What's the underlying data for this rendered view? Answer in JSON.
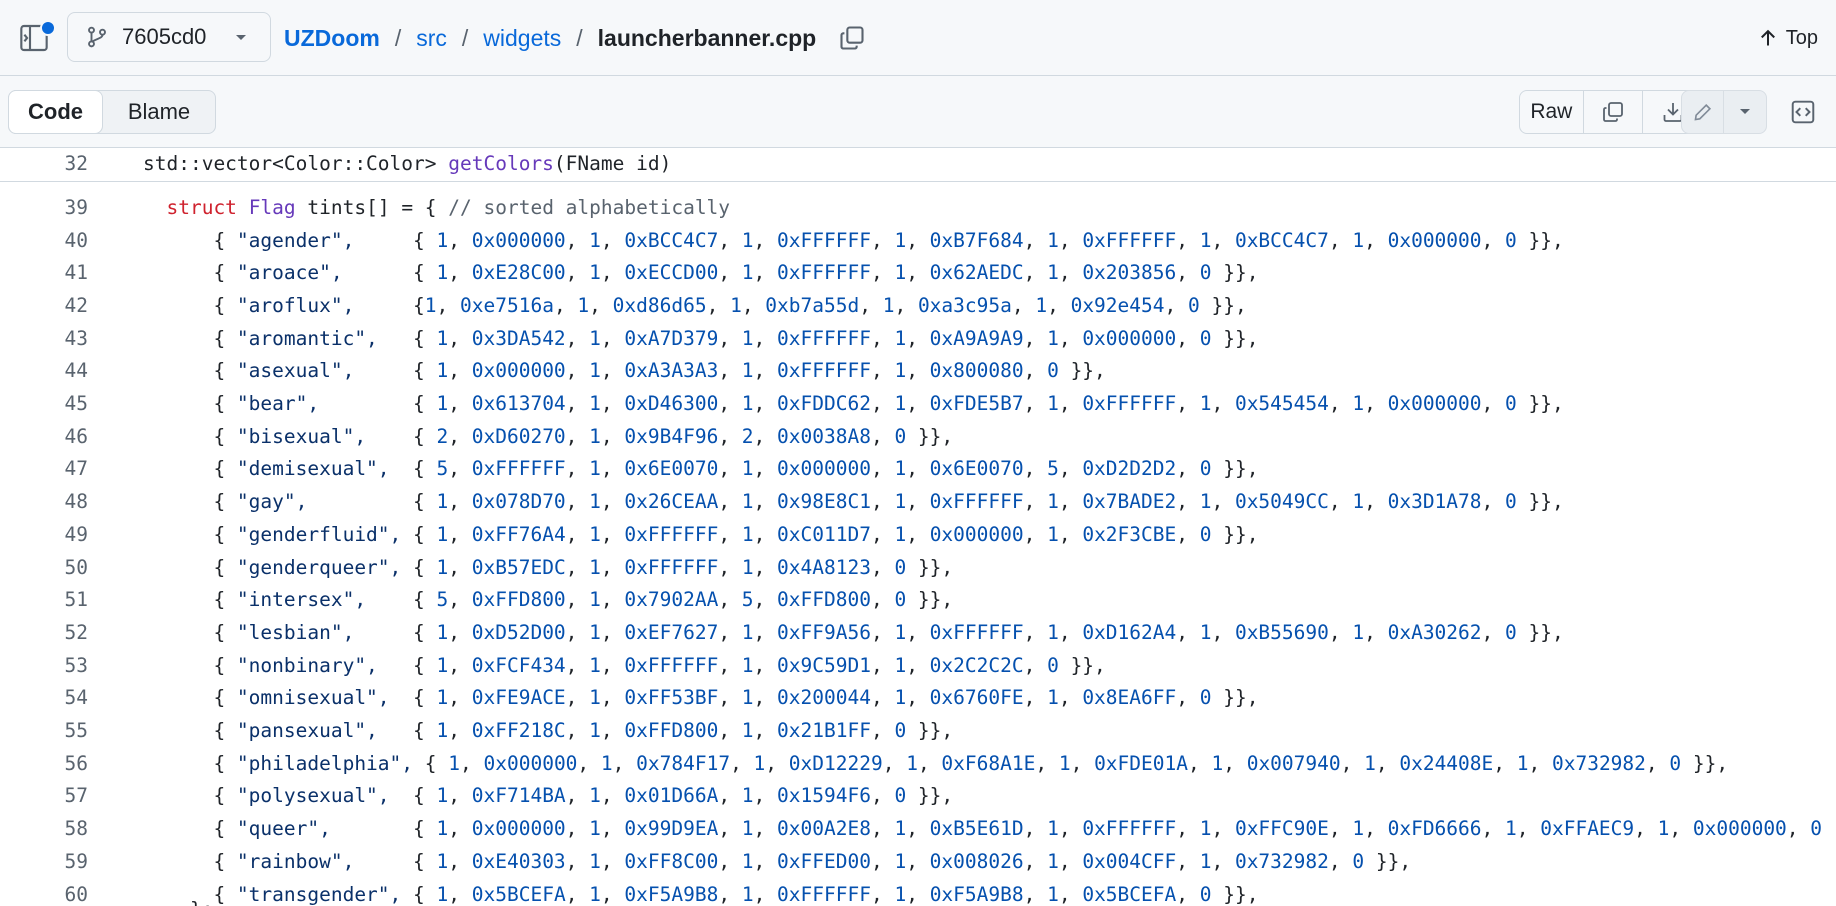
{
  "header": {
    "branch": "7605cd0",
    "breadcrumb": {
      "repo": "UZDoom",
      "path": [
        "src",
        "widgets"
      ],
      "sep": "/",
      "file": "launcherbanner.cpp"
    },
    "top_label": "Top"
  },
  "toolbar": {
    "tabs": [
      "Code",
      "Blame"
    ],
    "active_tab": "Code",
    "raw_label": "Raw"
  },
  "sticky": {
    "line": "32",
    "return_type": "std::vector<Color::Color> ",
    "func": "getColors",
    "params": "(FName id)"
  },
  "code": {
    "struct_line": {
      "ln": "39",
      "kw": "struct",
      "type": "Flag",
      "rest": " tints[] = { ",
      "comment": "// sorted alphabetically"
    },
    "flags": [
      {
        "ln": "40",
        "name": "\"agender\",",
        "values": [
          "1",
          "0x000000",
          "1",
          "0xBCC4C7",
          "1",
          "0xFFFFFF",
          "1",
          "0xB7F684",
          "1",
          "0xFFFFFF",
          "1",
          "0xBCC4C7",
          "1",
          "0x000000",
          "0"
        ]
      },
      {
        "ln": "41",
        "name": "\"aroace\",",
        "values": [
          "1",
          "0xE28C00",
          "1",
          "0xECCD00",
          "1",
          "0xFFFFFF",
          "1",
          "0x62AEDC",
          "1",
          "0x203856",
          "0"
        ]
      },
      {
        "ln": "42",
        "name": "\"aroflux\",",
        "nospace": true,
        "values": [
          "1",
          "0xe7516a",
          "1",
          "0xd86d65",
          "1",
          "0xb7a55d",
          "1",
          "0xa3c95a",
          "1",
          "0x92e454",
          "0"
        ]
      },
      {
        "ln": "43",
        "name": "\"aromantic\",",
        "values": [
          "1",
          "0x3DA542",
          "1",
          "0xA7D379",
          "1",
          "0xFFFFFF",
          "1",
          "0xA9A9A9",
          "1",
          "0x000000",
          "0"
        ]
      },
      {
        "ln": "44",
        "name": "\"asexual\",",
        "values": [
          "1",
          "0x000000",
          "1",
          "0xA3A3A3",
          "1",
          "0xFFFFFF",
          "1",
          "0x800080",
          "0"
        ]
      },
      {
        "ln": "45",
        "name": "\"bear\",",
        "values": [
          "1",
          "0x613704",
          "1",
          "0xD46300",
          "1",
          "0xFDDC62",
          "1",
          "0xFDE5B7",
          "1",
          "0xFFFFFF",
          "1",
          "0x545454",
          "1",
          "0x000000",
          "0"
        ]
      },
      {
        "ln": "46",
        "name": "\"bisexual\",",
        "values": [
          "2",
          "0xD60270",
          "1",
          "0x9B4F96",
          "2",
          "0x0038A8",
          "0"
        ]
      },
      {
        "ln": "47",
        "name": "\"demisexual\",",
        "values": [
          "5",
          "0xFFFFFF",
          "1",
          "0x6E0070",
          "1",
          "0x000000",
          "1",
          "0x6E0070",
          "5",
          "0xD2D2D2",
          "0"
        ]
      },
      {
        "ln": "48",
        "name": "\"gay\",",
        "values": [
          "1",
          "0x078D70",
          "1",
          "0x26CEAA",
          "1",
          "0x98E8C1",
          "1",
          "0xFFFFFF",
          "1",
          "0x7BADE2",
          "1",
          "0x5049CC",
          "1",
          "0x3D1A78",
          "0"
        ]
      },
      {
        "ln": "49",
        "name": "\"genderfluid\",",
        "values": [
          "1",
          "0xFF76A4",
          "1",
          "0xFFFFFF",
          "1",
          "0xC011D7",
          "1",
          "0x000000",
          "1",
          "0x2F3CBE",
          "0"
        ]
      },
      {
        "ln": "50",
        "name": "\"genderqueer\",",
        "values": [
          "1",
          "0xB57EDC",
          "1",
          "0xFFFFFF",
          "1",
          "0x4A8123",
          "0"
        ]
      },
      {
        "ln": "51",
        "name": "\"intersex\",",
        "values": [
          "5",
          "0xFFD800",
          "1",
          "0x7902AA",
          "5",
          "0xFFD800",
          "0"
        ]
      },
      {
        "ln": "52",
        "name": "\"lesbian\",",
        "values": [
          "1",
          "0xD52D00",
          "1",
          "0xEF7627",
          "1",
          "0xFF9A56",
          "1",
          "0xFFFFFF",
          "1",
          "0xD162A4",
          "1",
          "0xB55690",
          "1",
          "0xA30262",
          "0"
        ]
      },
      {
        "ln": "53",
        "name": "\"nonbinary\",",
        "values": [
          "1",
          "0xFCF434",
          "1",
          "0xFFFFFF",
          "1",
          "0x9C59D1",
          "1",
          "0x2C2C2C",
          "0"
        ]
      },
      {
        "ln": "54",
        "name": "\"omnisexual\",",
        "values": [
          "1",
          "0xFE9ACE",
          "1",
          "0xFF53BF",
          "1",
          "0x200044",
          "1",
          "0x6760FE",
          "1",
          "0x8EA6FF",
          "0"
        ]
      },
      {
        "ln": "55",
        "name": "\"pansexual\",",
        "values": [
          "1",
          "0xFF218C",
          "1",
          "0xFFD800",
          "1",
          "0x21B1FF",
          "0"
        ]
      },
      {
        "ln": "56",
        "name": "\"philadelphia\",",
        "values": [
          "1",
          "0x000000",
          "1",
          "0x784F17",
          "1",
          "0xD12229",
          "1",
          "0xF68A1E",
          "1",
          "0xFDE01A",
          "1",
          "0x007940",
          "1",
          "0x24408E",
          "1",
          "0x732982",
          "0"
        ]
      },
      {
        "ln": "57",
        "name": "\"polysexual\",",
        "values": [
          "1",
          "0xF714BA",
          "1",
          "0x01D66A",
          "1",
          "0x1594F6",
          "0"
        ]
      },
      {
        "ln": "58",
        "name": "\"queer\",",
        "truncated": true,
        "values": [
          "1",
          "0x000000",
          "1",
          "0x99D9EA",
          "1",
          "0x00A2E8",
          "1",
          "0xB5E61D",
          "1",
          "0xFFFFFF",
          "1",
          "0xFFC90E",
          "1",
          "0xFD6666",
          "1",
          "0xFFAEC9",
          "1",
          "0x000000",
          "0"
        ]
      },
      {
        "ln": "59",
        "name": "\"rainbow\",",
        "values": [
          "1",
          "0xE40303",
          "1",
          "0xFF8C00",
          "1",
          "0xFFED00",
          "1",
          "0x008026",
          "1",
          "0x004CFF",
          "1",
          "0x732982",
          "0"
        ]
      },
      {
        "ln": "60",
        "name": "\"transgender\",",
        "values": [
          "1",
          "0x5BCEFA",
          "1",
          "0xF5A9B8",
          "1",
          "0xFFFFFF",
          "1",
          "0xF5A9B8",
          "1",
          "0x5BCEFA",
          "0"
        ]
      }
    ]
  },
  "colors": {
    "accent": "#0969da",
    "keyword": "#cf222e",
    "type": "#6639ba",
    "string": "#0a3069",
    "number": "#0550ae",
    "comment": "#59636e"
  },
  "icons": [
    "sidebar-expand-icon",
    "git-branch-icon",
    "chevron-down-icon",
    "copy-icon",
    "arrow-up-icon",
    "download-icon",
    "pencil-icon",
    "code-square-icon"
  ]
}
